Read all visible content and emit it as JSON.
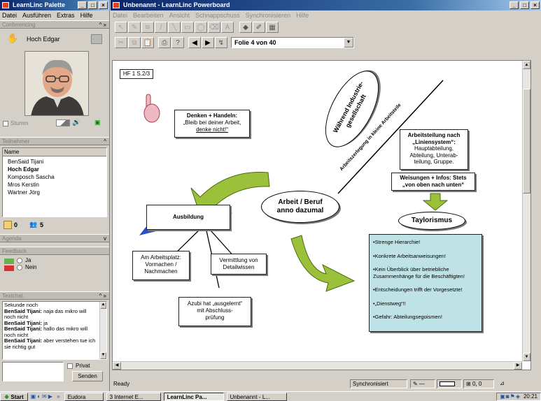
{
  "palette": {
    "title": "LearnLinc Palette",
    "menu": [
      "Datei",
      "Ausführen",
      "Extras",
      "Hilfe"
    ],
    "conferencing": {
      "header": "Conferencing",
      "presenter": "Hoch Edgar",
      "mute_label": "Stumm"
    },
    "participants": {
      "header": "Teilnehmer",
      "column": "Name",
      "items": [
        "BenSaid Tijani",
        "Hoch Edgar",
        "Komposch Sascha",
        "Mros Kerstin",
        "Wartner Jörg"
      ],
      "bold_index": 1,
      "count_a": "0",
      "count_b": "5"
    },
    "agenda": {
      "header": "Agenda"
    },
    "feedback": {
      "header": "Feedback",
      "yes": "Ja",
      "no": "Nein"
    },
    "textchat": {
      "header": "Textchat",
      "lines": [
        {
          "sender": "",
          "text": "Sekunde noch"
        },
        {
          "sender": "BenSaid Tijani:",
          "text": "naja das mikro will noch nicht"
        },
        {
          "sender": "BenSaid Tijani:",
          "text": "ja"
        },
        {
          "sender": "BenSaid Tijani:",
          "text": "hallo das mikro will noch nicht"
        },
        {
          "sender": "BenSaid Tijani:",
          "text": "aber verstehen tue ich sie richtig gut"
        }
      ],
      "private_label": "Privat",
      "send_label": "Senden"
    }
  },
  "board": {
    "title": "Unbenannt - LearnLinc Powerboard",
    "menu": [
      "Datei",
      "Bearbeiten",
      "Ansicht",
      "Schnappschuss",
      "Synchronisieren",
      "Hilfe"
    ],
    "slide_select": "Folie 4 von 40",
    "status": "Ready",
    "sync": "Synchronisiert",
    "coords": "0, 0"
  },
  "slide": {
    "ref": "HF 1 S.2/3",
    "think_title": "Denken + Handeln:",
    "think_text": "„Bleib bei deiner Arbeit,",
    "think_link": "denke nicht!“",
    "oval_top_1": "Während Industrie-",
    "oval_top_2": "gesellschaft",
    "diag_text": "Arbeitszerlegung in kleine Arbeitsteile",
    "division_title_1": "Arbeitsteilung nach",
    "division_title_2": "„Liniensystem“:",
    "division_text_1": "Hauptabteilung,",
    "division_text_2": "Abteilung, Unterab-",
    "division_text_3": "teilung, Gruppe.",
    "orders_1": "Weisungen + Infos: Stets",
    "orders_2": "„von oben nach unten“",
    "center_1": "Arbeit / Beruf",
    "center_2": "anno dazumal",
    "taylor": "Taylorismus",
    "training": "Ausbildung",
    "work1_1": "Am Arbeitsplatz:",
    "work1_2": "Vormachen /",
    "work1_3": "Nachmachen",
    "work2_1": "Vermittlung von",
    "work2_2": "Detailwissen",
    "trainee_1": "Azubi hat „ausgelernt“",
    "trainee_2": "mit Abschluss-",
    "trainee_3": "prüfung",
    "list": [
      "•Strenge Hierarchie!",
      "•Konkrete Arbeitsanweisungen!",
      "•Kein Überblick über betriebliche Zusammenhänge für die Beschäftigten!",
      "•Entscheidungen trifft der Vorgesetzte!",
      "•„Dienstweg“!!",
      "•Gefahr: Abteilungsegoismen!"
    ]
  },
  "taskbar": {
    "start": "Start",
    "items": [
      "Eudora",
      "3 Internet E...",
      "LearnLinc Pa...",
      "Unbenannt - L..."
    ],
    "clock": "20:21"
  }
}
